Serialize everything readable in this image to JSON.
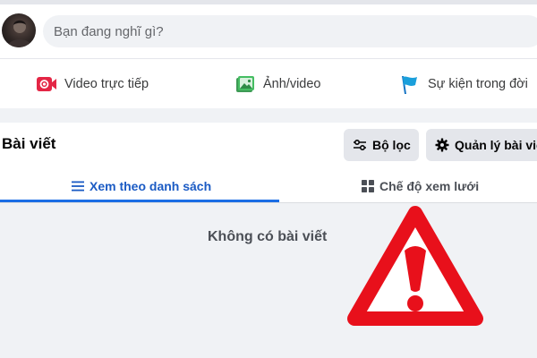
{
  "composer": {
    "placeholder": "Bạn đang nghĩ gì?",
    "actions": [
      {
        "label": "Video trực tiếp",
        "icon": "live-video-icon",
        "color": "#e42645"
      },
      {
        "label": "Ảnh/video",
        "icon": "photo-icon",
        "color": "#45bd62"
      },
      {
        "label": "Sự kiện trong đời",
        "icon": "flag-icon",
        "color": "#1a9fdb"
      }
    ]
  },
  "posts": {
    "title": "Bài viết",
    "filter_label": "Bộ lọc",
    "manage_label": "Quản lý bài viết",
    "tabs": [
      {
        "label": "Xem theo danh sách",
        "icon": "list-icon",
        "active": true
      },
      {
        "label": "Chế độ xem lưới",
        "icon": "grid-icon",
        "active": false
      }
    ],
    "empty_message": "Không có bài viết"
  },
  "colors": {
    "accent_blue": "#1b6ee5",
    "warning_red": "#e8101b"
  },
  "overlay_icon": "warning-triangle-icon"
}
